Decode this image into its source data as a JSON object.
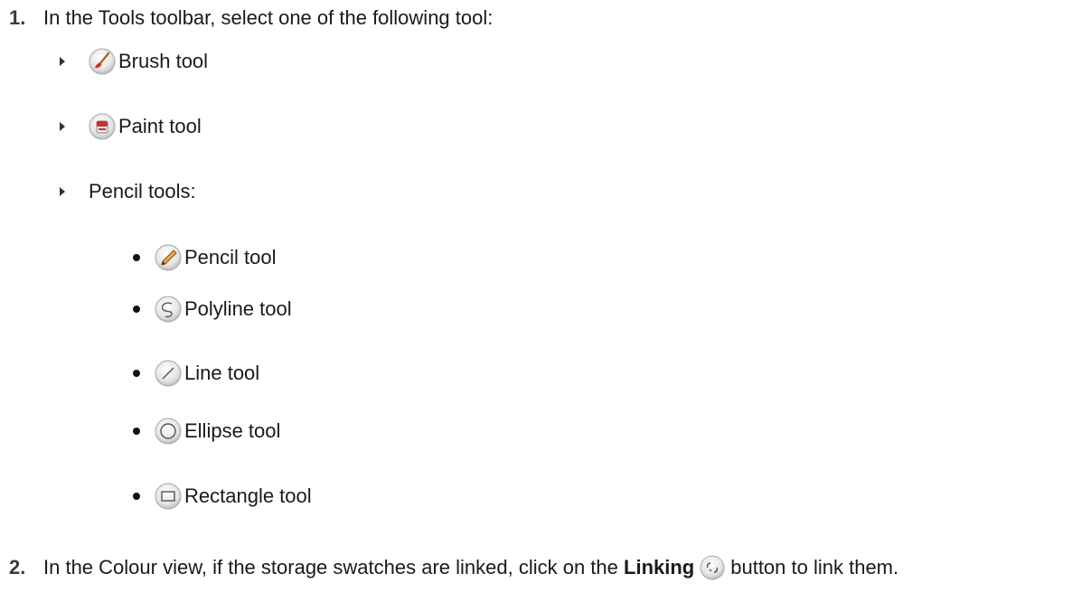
{
  "steps": [
    {
      "number": "1.",
      "text": "In the Tools toolbar, select one of the following tool:"
    },
    {
      "number": "2.",
      "before": "In the Colour view, if the storage swatches are linked, click on the",
      "bold": "Linking",
      "after": "button to link them."
    }
  ],
  "tools": [
    {
      "label": "Brush tool",
      "icon": "brush-icon"
    },
    {
      "label": "Paint tool",
      "icon": "paint-bucket-icon"
    },
    {
      "label": "Pencil tools:"
    }
  ],
  "pencil_tools": [
    {
      "label": "Pencil tool",
      "icon": "pencil-icon"
    },
    {
      "label": "Polyline tool",
      "icon": "polyline-icon"
    },
    {
      "label": "Line tool",
      "icon": "line-icon"
    },
    {
      "label": "Ellipse tool",
      "icon": "ellipse-icon"
    },
    {
      "label": "Rectangle tool",
      "icon": "rectangle-icon"
    }
  ],
  "link_icon": "linking-icon"
}
